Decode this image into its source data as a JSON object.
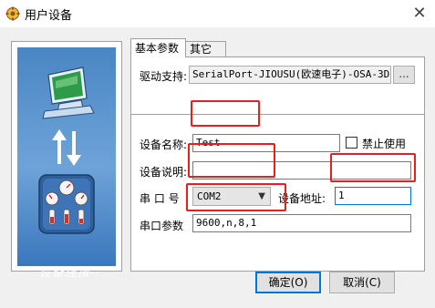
{
  "window": {
    "title": "用户设备",
    "close_glyph": "✕"
  },
  "left_panel": {
    "caption": "设备连接--"
  },
  "tabs": [
    {
      "label": "基本参数",
      "active": true
    },
    {
      "label": "其它",
      "active": false
    }
  ],
  "form": {
    "driver_label": "驱动支持:",
    "driver_value": "SerialPort-JIOUSU(欧速电子)-OSA-3D",
    "browse_label": "...",
    "device_name_label": "设备名称:",
    "device_name_value": "Test",
    "disable_label": "禁止使用",
    "disable_checked": false,
    "device_desc_label": "设备说明:",
    "device_desc_value": "",
    "port_label": "串 口 号",
    "port_value": "COM2",
    "address_label": "设备地址:",
    "address_value": "1",
    "serial_params_label": "串口参数",
    "serial_params_value": "9600,n,8,1"
  },
  "buttons": {
    "ok_label": "确定(O)",
    "cancel_label": "取消(C)"
  },
  "colors": {
    "highlight_box": "#e8201c",
    "accent": "#0078d7",
    "panel_blue": "#4a86c4"
  }
}
